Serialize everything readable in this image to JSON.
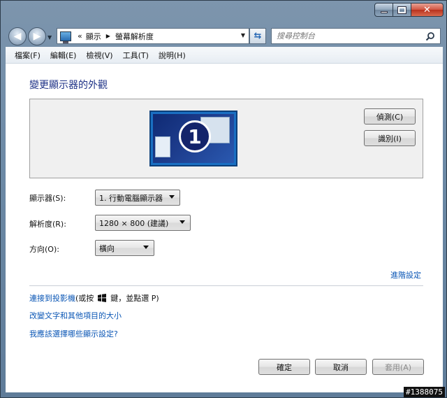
{
  "window": {
    "minimize_icon": "minimize-icon",
    "maximize_icon": "maximize-icon",
    "close_label": "✕"
  },
  "nav": {
    "address_prefix": "«",
    "breadcrumb": [
      "顯示",
      "螢幕解析度"
    ],
    "search_placeholder": "搜尋控制台"
  },
  "menu": {
    "items": [
      "檔案(F)",
      "編輯(E)",
      "檢視(V)",
      "工具(T)",
      "說明(H)"
    ]
  },
  "main": {
    "title": "變更顯示器的外觀",
    "monitor_number": "1",
    "detect_button": "偵測(C)",
    "identify_button": "識別(I)",
    "display_label": "顯示器(S):",
    "display_value": "1. 行動電腦顯示器",
    "resolution_label": "解析度(R):",
    "resolution_value": "1280 × 800 (建議)",
    "orientation_label": "方向(O):",
    "orientation_value": "橫向",
    "advanced_link": "進階設定",
    "projector_link": "連接到投影機",
    "projector_hint_1": " (或按 ",
    "projector_hint_2": " 鍵，並點選 P)",
    "text_size_link": "改變文字和其他項目的大小",
    "which_settings_link": "我應該選擇哪些顯示設定?"
  },
  "footer": {
    "ok": "確定",
    "cancel": "取消",
    "apply": "套用(A)"
  },
  "watermark": "#1388075",
  "colors": {
    "link": "#0a56b5",
    "title": "#1e3287",
    "monitor": "#1a6fc2"
  }
}
